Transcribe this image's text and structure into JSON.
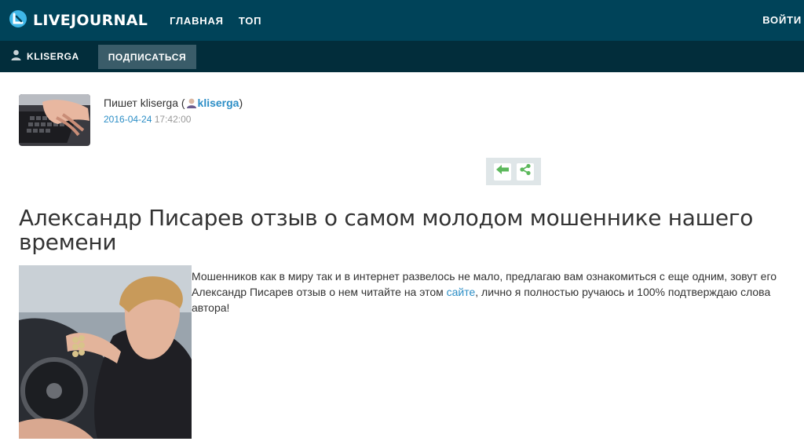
{
  "header": {
    "logo_text": "LIVEJOURNAL",
    "nav": [
      "ГЛАВНАЯ",
      "ТОП"
    ],
    "login": "ВОЙТИ",
    "colors": {
      "bar": "#004359",
      "subbar": "#022d3b",
      "button": "#3a5c69"
    }
  },
  "subbar": {
    "username": "KLISERGA",
    "subscribe_label": "ПОДПИСАТЬСЯ"
  },
  "post": {
    "byline_prefix": "Пишет kliserga (",
    "author_link": "kliserga",
    "byline_suffix": ")",
    "date": "2016-04-24",
    "time": "17:42:00",
    "title": "Александр Писарев отзыв о самом молодом мошеннике нашего времени",
    "body_part1": "Мошенников как в миру так и в интернет развелось не мало, предлагаю вам ознакомиться с еще одним, зовут его Александр Писарев отзыв о нем читайте на этом ",
    "body_link": "сайте",
    "body_part2": ", лично я полностью ручаюсь и 100% подтверждаю слова автора!",
    "link_color": "#2c8ec6"
  },
  "toolbar": {
    "icons": [
      "arrow-left-icon",
      "share-icon"
    ],
    "icon_color": "#5cb85c"
  }
}
